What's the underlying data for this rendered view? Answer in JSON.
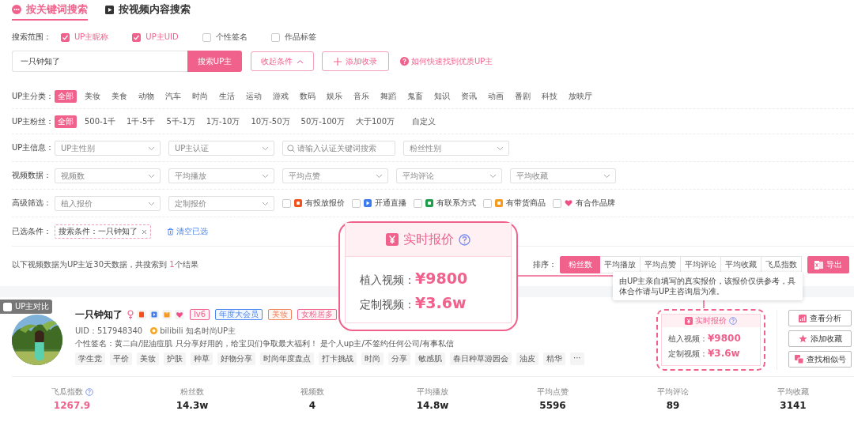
{
  "search_tabs": [
    {
      "label": "按关键词搜索",
      "selected": true,
      "kind": "keyword"
    },
    {
      "label": "按视频内容搜索",
      "selected": false,
      "kind": "video"
    }
  ],
  "scope": {
    "label": "搜索范围：",
    "options": [
      {
        "label": "UP主昵称",
        "checked": true
      },
      {
        "label": "UP主UID",
        "checked": true
      },
      {
        "label": "个性签名",
        "checked": false
      },
      {
        "label": "作品标签",
        "checked": false
      }
    ]
  },
  "search": {
    "value": "一只钟知了",
    "button": "搜索UP主",
    "collapse": "收起条件",
    "add": "添加收录",
    "help_link": "如何快速找到优质UP主"
  },
  "filters": [
    {
      "kind": "chips",
      "label": "UP主分类：",
      "options": [
        {
          "label": "全部",
          "selected": true
        },
        {
          "label": "美妆",
          "selected": false
        },
        {
          "label": "美食",
          "selected": false
        },
        {
          "label": "动物",
          "selected": false
        },
        {
          "label": "汽车",
          "selected": false
        },
        {
          "label": "时尚",
          "selected": false
        },
        {
          "label": "生活",
          "selected": false
        },
        {
          "label": "运动",
          "selected": false
        },
        {
          "label": "游戏",
          "selected": false
        },
        {
          "label": "数码",
          "selected": false
        },
        {
          "label": "娱乐",
          "selected": false
        },
        {
          "label": "音乐",
          "selected": false
        },
        {
          "label": "舞蹈",
          "selected": false
        },
        {
          "label": "鬼畜",
          "selected": false
        },
        {
          "label": "知识",
          "selected": false
        },
        {
          "label": "资讯",
          "selected": false
        },
        {
          "label": "动画",
          "selected": false
        },
        {
          "label": "番剧",
          "selected": false
        },
        {
          "label": "科技",
          "selected": false
        },
        {
          "label": "放映厅",
          "selected": false
        }
      ]
    },
    {
      "kind": "chips",
      "label": "UP主粉丝：",
      "options": [
        {
          "label": "全部",
          "selected": true
        },
        {
          "label": "500-1千",
          "selected": false
        },
        {
          "label": "1千-5千",
          "selected": false
        },
        {
          "label": "5千-1万",
          "selected": false
        },
        {
          "label": "1万-10万",
          "selected": false
        },
        {
          "label": "10万-50万",
          "selected": false
        },
        {
          "label": "50万-100万",
          "selected": false
        },
        {
          "label": "大于100万",
          "selected": false
        },
        {
          "label": "自定义",
          "selected": false
        }
      ]
    },
    {
      "kind": "fields",
      "label": "UP主信息：",
      "fields": [
        {
          "kind": "select",
          "placeholder": "UP主性别"
        },
        {
          "kind": "select",
          "placeholder": "UP主认证"
        },
        {
          "kind": "search",
          "placeholder": "请输入认证关键词搜索"
        },
        {
          "kind": "select",
          "placeholder": "粉丝性别"
        }
      ]
    },
    {
      "kind": "fields",
      "label": "视频数据：",
      "fields": [
        {
          "kind": "select",
          "placeholder": "视频数"
        },
        {
          "kind": "select",
          "placeholder": "平均播放"
        },
        {
          "kind": "select",
          "placeholder": "平均点赞"
        },
        {
          "kind": "select",
          "placeholder": "平均评论"
        },
        {
          "kind": "select",
          "placeholder": "平均收藏"
        }
      ]
    },
    {
      "kind": "fields",
      "label": "高级筛选：",
      "fields": [
        {
          "kind": "select",
          "placeholder": "植入报价"
        },
        {
          "kind": "select",
          "placeholder": "定制报价"
        }
      ],
      "checks": [
        {
          "label": "有投放报价",
          "checked": false,
          "kind": "square",
          "color": "#f0521e"
        },
        {
          "label": "开通直播",
          "checked": false,
          "kind": "play",
          "color": "#3c7cf0"
        },
        {
          "label": "有联系方式",
          "checked": false,
          "kind": "square",
          "color": "#1e9e4a"
        },
        {
          "label": "有带货商品",
          "checked": false,
          "kind": "square",
          "color": "#f59a1e"
        },
        {
          "label": "有合作品牌",
          "checked": false,
          "kind": "heart",
          "color": "#f0508a"
        }
      ]
    }
  ],
  "selected_conditions": {
    "label": "已选条件：",
    "tags": [
      "搜索条件：一只钟知了"
    ],
    "clear": "清空已选"
  },
  "results": {
    "before": "以下视频数据为UP主近30天数据，共搜索到 ",
    "count": "1",
    "after": "个结果"
  },
  "sort": {
    "label": "排序：",
    "options": [
      {
        "label": "粉丝数",
        "selected": true
      },
      {
        "label": "平均播放",
        "selected": false
      },
      {
        "label": "平均点赞",
        "selected": false
      },
      {
        "label": "平均评论",
        "selected": false
      },
      {
        "label": "平均收藏",
        "selected": false
      },
      {
        "label": "飞瓜指数",
        "selected": false
      }
    ],
    "export": "导出"
  },
  "card": {
    "compare": {
      "label": "UP主对比",
      "checked": false
    },
    "name": "一只钟知了",
    "badges": [
      {
        "label": "lv6",
        "color": "#f0628c"
      },
      {
        "label": "年度大会员",
        "color": "#4a86f0"
      },
      {
        "label": "美妆",
        "color": "#f0845a"
      },
      {
        "label": "女粉居多",
        "color": "#f0628c"
      }
    ],
    "uid": "UID：517948340",
    "verified": "bilibili 知名时尚UP主",
    "signature": "个性签名：黄二白/混油痘肌 只分享好用的，给宝贝们争取最大福利！ 是个人up主/不签约任何公司/有事私信",
    "tags": [
      "学生党",
      "平价",
      "美妆",
      "护肤",
      "种草",
      "好物分享",
      "时尚年度盘点",
      "打卡挑战",
      "时尚",
      "分享",
      "敏感肌",
      "春日种草游园会",
      "油皮",
      "精华",
      "···"
    ],
    "quote": {
      "title": "实时报价",
      "items": [
        {
          "label": "植入视频：",
          "value": "¥9800"
        },
        {
          "label": "定制视频：",
          "value": "¥3.6w"
        }
      ]
    },
    "actions": [
      {
        "label": "查看分析",
        "kind": "chart"
      },
      {
        "label": "添加收藏",
        "kind": "star"
      },
      {
        "label": "查找相似号",
        "kind": "copy"
      }
    ]
  },
  "stats": [
    {
      "label": "飞瓜指数",
      "value": "1267.9",
      "highlight": true,
      "help": true
    },
    {
      "label": "粉丝数",
      "value": "14.3w",
      "highlight": false,
      "help": false
    },
    {
      "label": "视频数",
      "value": "4",
      "highlight": false,
      "help": false
    },
    {
      "label": "平均播放",
      "value": "14.8w",
      "highlight": false,
      "help": false
    },
    {
      "label": "平均点赞",
      "value": "5596",
      "highlight": false,
      "help": false
    },
    {
      "label": "平均评论",
      "value": "89",
      "highlight": false,
      "help": false
    },
    {
      "label": "平均收藏",
      "value": "3141",
      "highlight": false,
      "help": false
    }
  ],
  "callout": {
    "title": "实时报价",
    "items": [
      {
        "label": "植入视频：",
        "value": "¥9800"
      },
      {
        "label": "定制视频：",
        "value": "¥3.6w"
      }
    ]
  },
  "tooltip": "由UP主亲自填写的真实报价，该报价仅供参考，具体合作请与UP主咨询后为准。"
}
